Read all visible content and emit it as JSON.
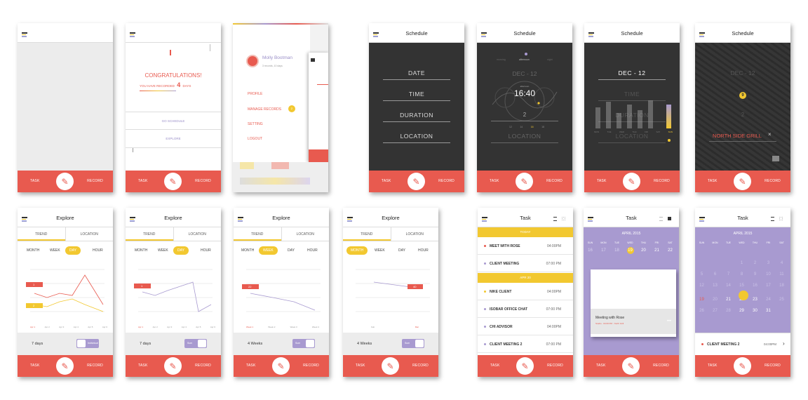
{
  "bottom_bar": {
    "task": "TASK",
    "record": "RECORD",
    "pencil_icon": "pencil-icon",
    "accent": "#e85a4f"
  },
  "colors": {
    "yellow": "#f2c830",
    "purple": "#a89ad0",
    "dark": "#333333",
    "red": "#e85a4f"
  },
  "s2": {
    "congrats": "CONGRATULATIONS!",
    "recorded_prefix": "YOU HAVE RECORDED",
    "days_count": "4",
    "days_suffix": "DAYS",
    "go_schedule": "GO SCHEDULE",
    "explore": "EXPLORE"
  },
  "s3": {
    "user_name": "Molly Bootman",
    "user_meta": "3 records, 10 days",
    "menu": [
      "PROFILE",
      "MANAGE RECORDS",
      "SETTING",
      "LOGOUT"
    ],
    "badge": "2"
  },
  "schedule": {
    "title": "Schedule",
    "fields": [
      "DATE",
      "TIME",
      "DURATION",
      "LOCATION"
    ],
    "dayparts": [
      "morning",
      "afternoon",
      "night"
    ],
    "date": "DEC - 12",
    "time": "16:40",
    "time_label": "afternoon",
    "duration": "2",
    "ticks": [
      "12",
      "14",
      "16",
      "18"
    ],
    "days": [
      "MON",
      "TUE",
      "WED",
      "THU",
      "FRI",
      "SAT",
      "SUN"
    ],
    "hour": "9",
    "location": "NORTH SIDE GRILL",
    "close": "×"
  },
  "explore": {
    "title": "Explore",
    "tabs": [
      "TREND",
      "LOCATION"
    ],
    "periods": [
      "MONTH",
      "WEEK",
      "DAY",
      "HOUR"
    ],
    "s1": {
      "xlabels": [
        "Apr 1",
        "Apr 2",
        "Apr 3",
        "Apr 4",
        "Apr 5",
        "Apr 6"
      ],
      "tag1": "1",
      "tag2": "2",
      "foot": "7 days",
      "toggle": "Individual"
    },
    "s2": {
      "xlabels": [
        "Apr 1",
        "Apr 2",
        "Apr 3",
        "Apr 4",
        "Apr 5",
        "Apr 6"
      ],
      "tag": "1",
      "foot": "7 days",
      "toggle": "Sum"
    },
    "s3": {
      "xlabels": [
        "Week 1",
        "Week 2",
        "Week 3",
        "Week 4"
      ],
      "tag": "22",
      "foot": "4 Weeks",
      "toggle": "Sum"
    },
    "s4": {
      "xlabels": [
        "Feb",
        "Mar"
      ],
      "tag": "40",
      "foot": "4 Weeks",
      "toggle": "Sum"
    }
  },
  "task": {
    "title": "Task",
    "today": "TODAY",
    "apr20": "APR 20",
    "rows": [
      {
        "name": "MEET WITH ROSE",
        "time": "04:00PM"
      },
      {
        "name": "CLIENT MEETING",
        "time": "07:00 PM"
      },
      {
        "name": "NIKE CLIENT",
        "time": "04:00PM"
      },
      {
        "name": "ISOBAR OFFICE CHAT",
        "time": "07:00 PM"
      },
      {
        "name": "CHI ADVISOR",
        "time": "04:00PM"
      },
      {
        "name": "CLIENT MEETING 2",
        "time": "07:00 PM"
      }
    ],
    "month": "APRIL 2015",
    "weekdays": [
      "SUN",
      "MON",
      "TUE",
      "WED",
      "THU",
      "FRI",
      "SAT"
    ],
    "week_row": [
      "16",
      "17",
      "18",
      "19",
      "20",
      "21",
      "22"
    ],
    "card_title": "Meeting with Rose",
    "card_meta": "Studio · 04:00 PM · North Grill",
    "selected_day": "19",
    "bottom_task": {
      "name": "CLIENT MEETING 2",
      "time": "04:00PM"
    }
  }
}
